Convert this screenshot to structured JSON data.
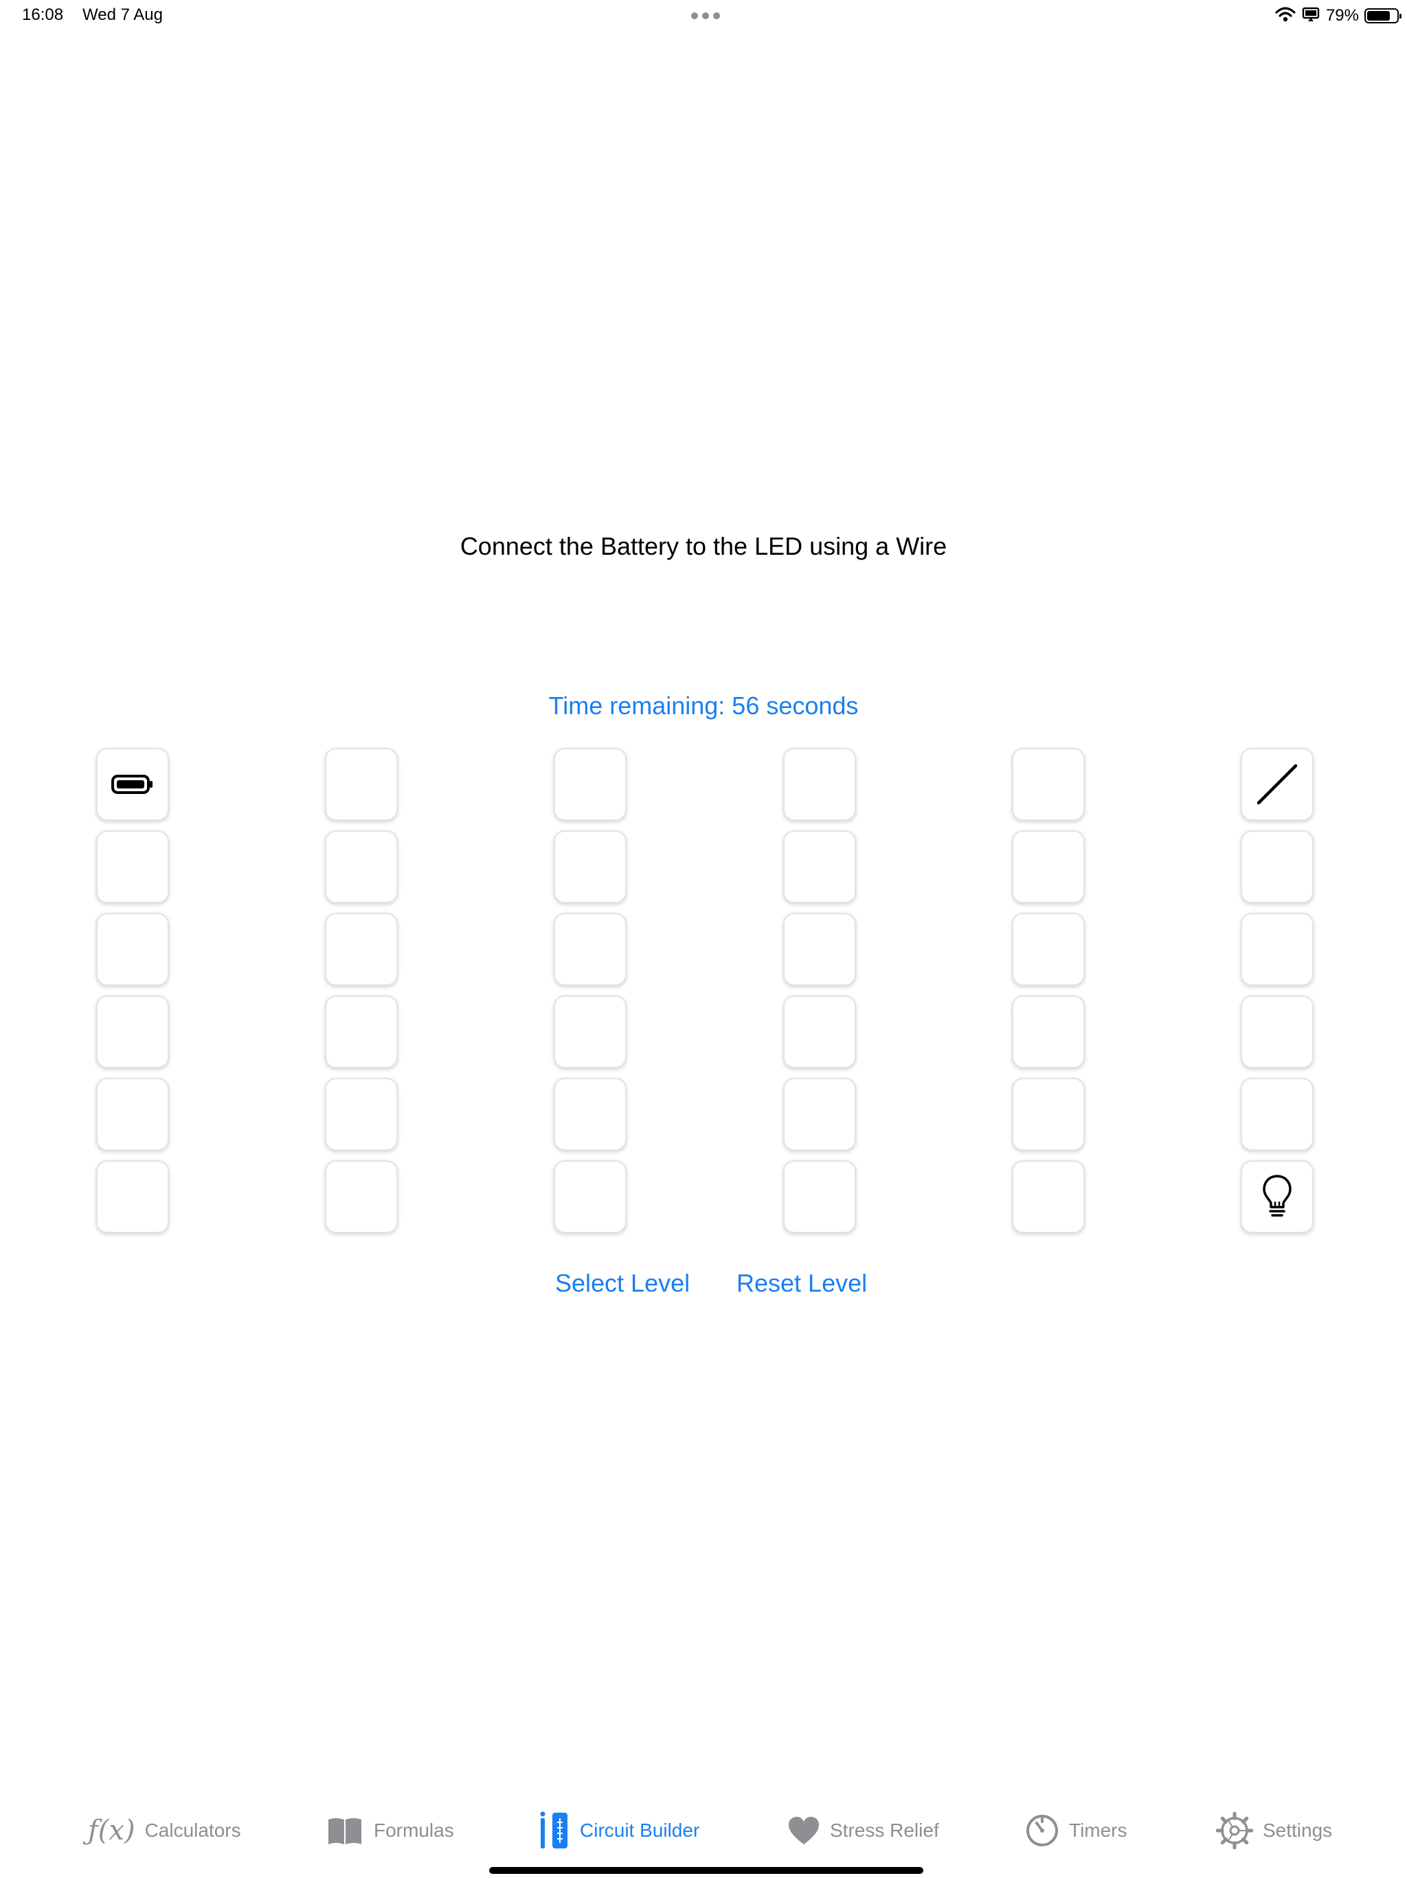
{
  "status_bar": {
    "time": "16:08",
    "date": "Wed 7 Aug",
    "battery_percent": "79%",
    "battery_level": 0.79,
    "icons": [
      "wifi-icon",
      "screen-mirroring-icon",
      "battery-icon"
    ]
  },
  "game": {
    "instruction": "Connect the Battery to the LED using a Wire",
    "timer_text": "Time remaining: 56 seconds",
    "grid": {
      "rows": 6,
      "columns": 6,
      "pieces": [
        {
          "row": 1,
          "column": 1,
          "piece": "battery",
          "icon": "battery-icon"
        },
        {
          "row": 1,
          "column": 6,
          "piece": "wire",
          "icon": "wire-icon"
        },
        {
          "row": 6,
          "column": 6,
          "piece": "led",
          "icon": "lightbulb-icon"
        }
      ]
    },
    "buttons": {
      "select_level": "Select Level",
      "reset_level": "Reset Level"
    }
  },
  "tab_bar": {
    "tabs": [
      {
        "label": "Calculators",
        "icon": "function-icon",
        "active": false
      },
      {
        "label": "Formulas",
        "icon": "book-icon",
        "active": false
      },
      {
        "label": "Circuit Builder",
        "icon": "circuit-builder-icon",
        "active": true
      },
      {
        "label": "Stress Relief",
        "icon": "heart-icon",
        "active": false
      },
      {
        "label": "Timers",
        "icon": "timer-icon",
        "active": false
      },
      {
        "label": "Settings",
        "icon": "gear-icon",
        "active": false
      }
    ]
  },
  "colors": {
    "accent": "#1a7ff0",
    "inactive_tab": "#8e8e93",
    "cell_border": "#e3e3e6",
    "background": "#ffffff"
  }
}
